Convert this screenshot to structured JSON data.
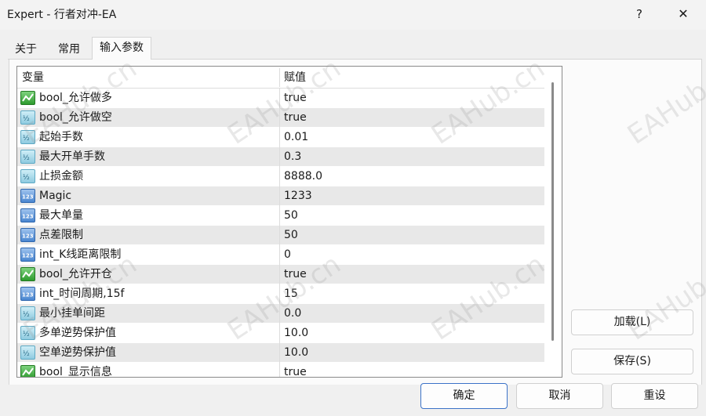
{
  "window": {
    "title": "Expert - 行者对冲-EA",
    "help_symbol": "?",
    "close_symbol": "✕"
  },
  "tabs": [
    {
      "label": "关于",
      "active": false
    },
    {
      "label": "常用",
      "active": false
    },
    {
      "label": "输入参数",
      "active": true
    }
  ],
  "grid": {
    "columns": [
      "变量",
      "赋值"
    ],
    "rows": [
      {
        "type": "bool",
        "name": "bool_允许做多",
        "value": "true"
      },
      {
        "type": "double",
        "name": "bool_允许做空",
        "value": "true"
      },
      {
        "type": "double",
        "name": "起始手数",
        "value": "0.01"
      },
      {
        "type": "double",
        "name": "最大开单手数",
        "value": "0.3"
      },
      {
        "type": "double",
        "name": "止损金额",
        "value": "8888.0"
      },
      {
        "type": "int",
        "name": "Magic",
        "value": "1233"
      },
      {
        "type": "int",
        "name": "最大单量",
        "value": "50"
      },
      {
        "type": "int",
        "name": "点差限制",
        "value": "50"
      },
      {
        "type": "int",
        "name": "int_K线距离限制",
        "value": "0"
      },
      {
        "type": "bool",
        "name": "bool_允许开仓",
        "value": "true"
      },
      {
        "type": "int",
        "name": "int_时间周期,15f",
        "value": "15"
      },
      {
        "type": "double",
        "name": "最小挂单间距",
        "value": "0.0"
      },
      {
        "type": "double",
        "name": "多单逆势保护值",
        "value": "10.0"
      },
      {
        "type": "double",
        "name": "空单逆势保护值",
        "value": "10.0"
      },
      {
        "type": "bool",
        "name": "bool_显示信息",
        "value": "true"
      }
    ]
  },
  "buttons": {
    "load": "加载(L)",
    "save": "保存(S)",
    "ok": "确定",
    "cancel": "取消",
    "reset": "重设"
  },
  "watermark": "EAHub.cn"
}
